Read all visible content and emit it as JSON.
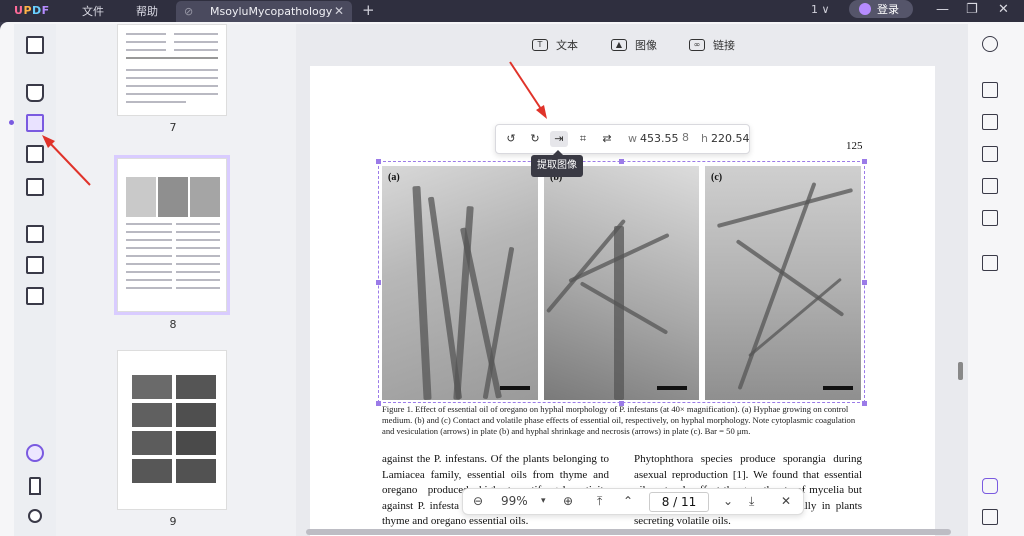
{
  "titlebar": {
    "logo": "UPDF",
    "menu_file": "文件",
    "menu_help": "帮助",
    "tab_name": "MsoyluMycopathology",
    "page_indicator": "1 ∨",
    "login": "登录"
  },
  "doc_toolbar": {
    "text": "文本",
    "image": "图像",
    "link": "链接"
  },
  "image_toolbar": {
    "w_label": "w",
    "w_value": "453.55",
    "h_label": "h",
    "h_value": "220.54",
    "tooltip": "提取图像"
  },
  "thumbnails": [
    {
      "number": "7"
    },
    {
      "number": "8"
    },
    {
      "number": "9"
    }
  ],
  "page": {
    "number": "125",
    "figure_labels": [
      "(a)",
      "(b)",
      "(c)"
    ],
    "caption": "Figure 1. Effect of essential oil of oregano on hyphal morphology of P. infestans (at 40× magnification). (a) Hyphae growing on control medium. (b) and (c) Contact and volatile phase effects of essential oil, respectively, on hyphal morphology. Note cytoplasmic coagulation and vesiculation (arrows) in plate (b) and hyphal shrinkage and necrosis (arrows) in plate (c). Bar = 50 μm.",
    "left_column": "against the P. infestans. Of the plants belonging to Lamiacea family, essential oils from thyme and oregano produced highest antifungal activity against P. infesta also exhibited a much less than thyme and oregano essential oils.",
    "right_column": "Phytophthora species produce sporangia during asexual reproduction [1]. We found that essential oils not only affect the growth rate of mycelia but may influence vo conditions especially in plants secreting volatile oils."
  },
  "nav": {
    "zoom": "99%",
    "current_page": "8",
    "separator": "/",
    "total_pages": "11"
  },
  "colors": {
    "accent": "#7a5ae0",
    "annotation_arrow": "#e0332a",
    "titlebar": "#2f2f3f"
  }
}
